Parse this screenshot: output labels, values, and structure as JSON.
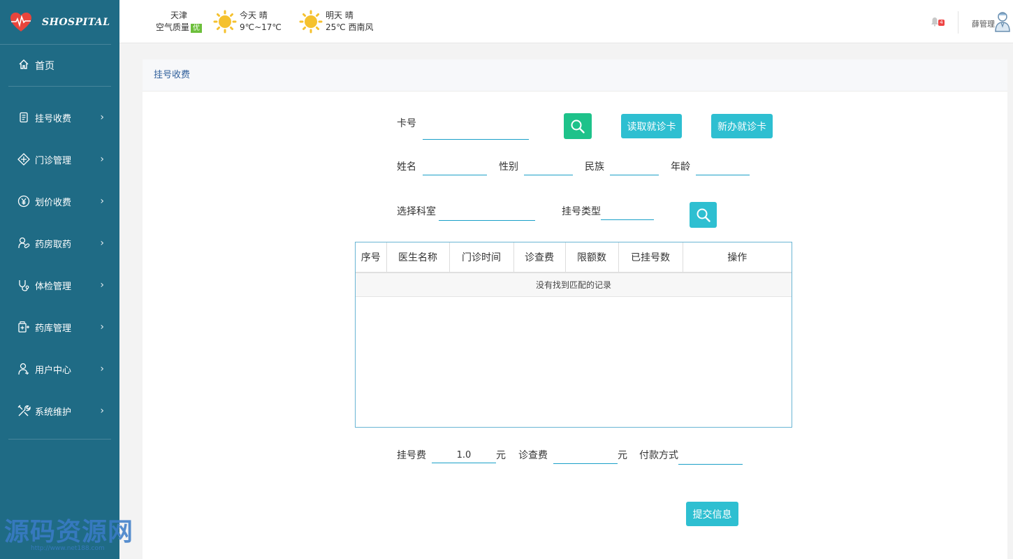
{
  "brand": {
    "name": "SHOSPITAL"
  },
  "nav": {
    "home": "首页",
    "items": [
      {
        "label": "挂号收费",
        "icon": "register-icon"
      },
      {
        "label": "门诊管理",
        "icon": "clinic-icon"
      },
      {
        "label": "划价收费",
        "icon": "yuan-icon"
      },
      {
        "label": "药房取药",
        "icon": "pharmacy-icon"
      },
      {
        "label": "体检管理",
        "icon": "stethoscope-icon"
      },
      {
        "label": "药库管理",
        "icon": "medicine-store-icon"
      },
      {
        "label": "用户中心",
        "icon": "user-icon"
      },
      {
        "label": "系统维护",
        "icon": "tools-icon"
      }
    ]
  },
  "header": {
    "city": "天津",
    "air_quality_label": "空气质量",
    "air_quality_value": "优",
    "today": {
      "label": "今天",
      "weather": "晴",
      "temp": "9℃~17℃"
    },
    "tomorrow": {
      "label": "明天",
      "weather": "晴",
      "temp": "25℃ 西南风"
    },
    "notification_count": "4",
    "user": "薛管理"
  },
  "panel": {
    "title": "挂号收费"
  },
  "form": {
    "card_no_label": "卡号",
    "card_no_value": "",
    "read_card_button": "读取就诊卡",
    "new_card_button": "新办就诊卡",
    "name_label": "姓名",
    "gender_label": "性别",
    "ethnicity_label": "民族",
    "age_label": "年龄",
    "department_label": "选择科室",
    "reg_type_label": "挂号类型",
    "reg_fee_label": "挂号费",
    "reg_fee_value": "1.0",
    "yuan": "元",
    "exam_fee_label": "诊查费",
    "exam_fee_value": "",
    "payment_label": "付款方式",
    "submit_button": "提交信息"
  },
  "table": {
    "columns": [
      "序号",
      "医生名称",
      "门诊时间",
      "诊查费",
      "限额数",
      "已挂号数",
      "操作"
    ],
    "empty_text": "没有找到匹配的记录"
  },
  "watermark": {
    "text": "源码资源网",
    "url": "http://www.net188.com"
  },
  "colors": {
    "sidebar": "#1f6b85",
    "accent": "#2ebfd1",
    "search_green": "#1ec28a"
  }
}
